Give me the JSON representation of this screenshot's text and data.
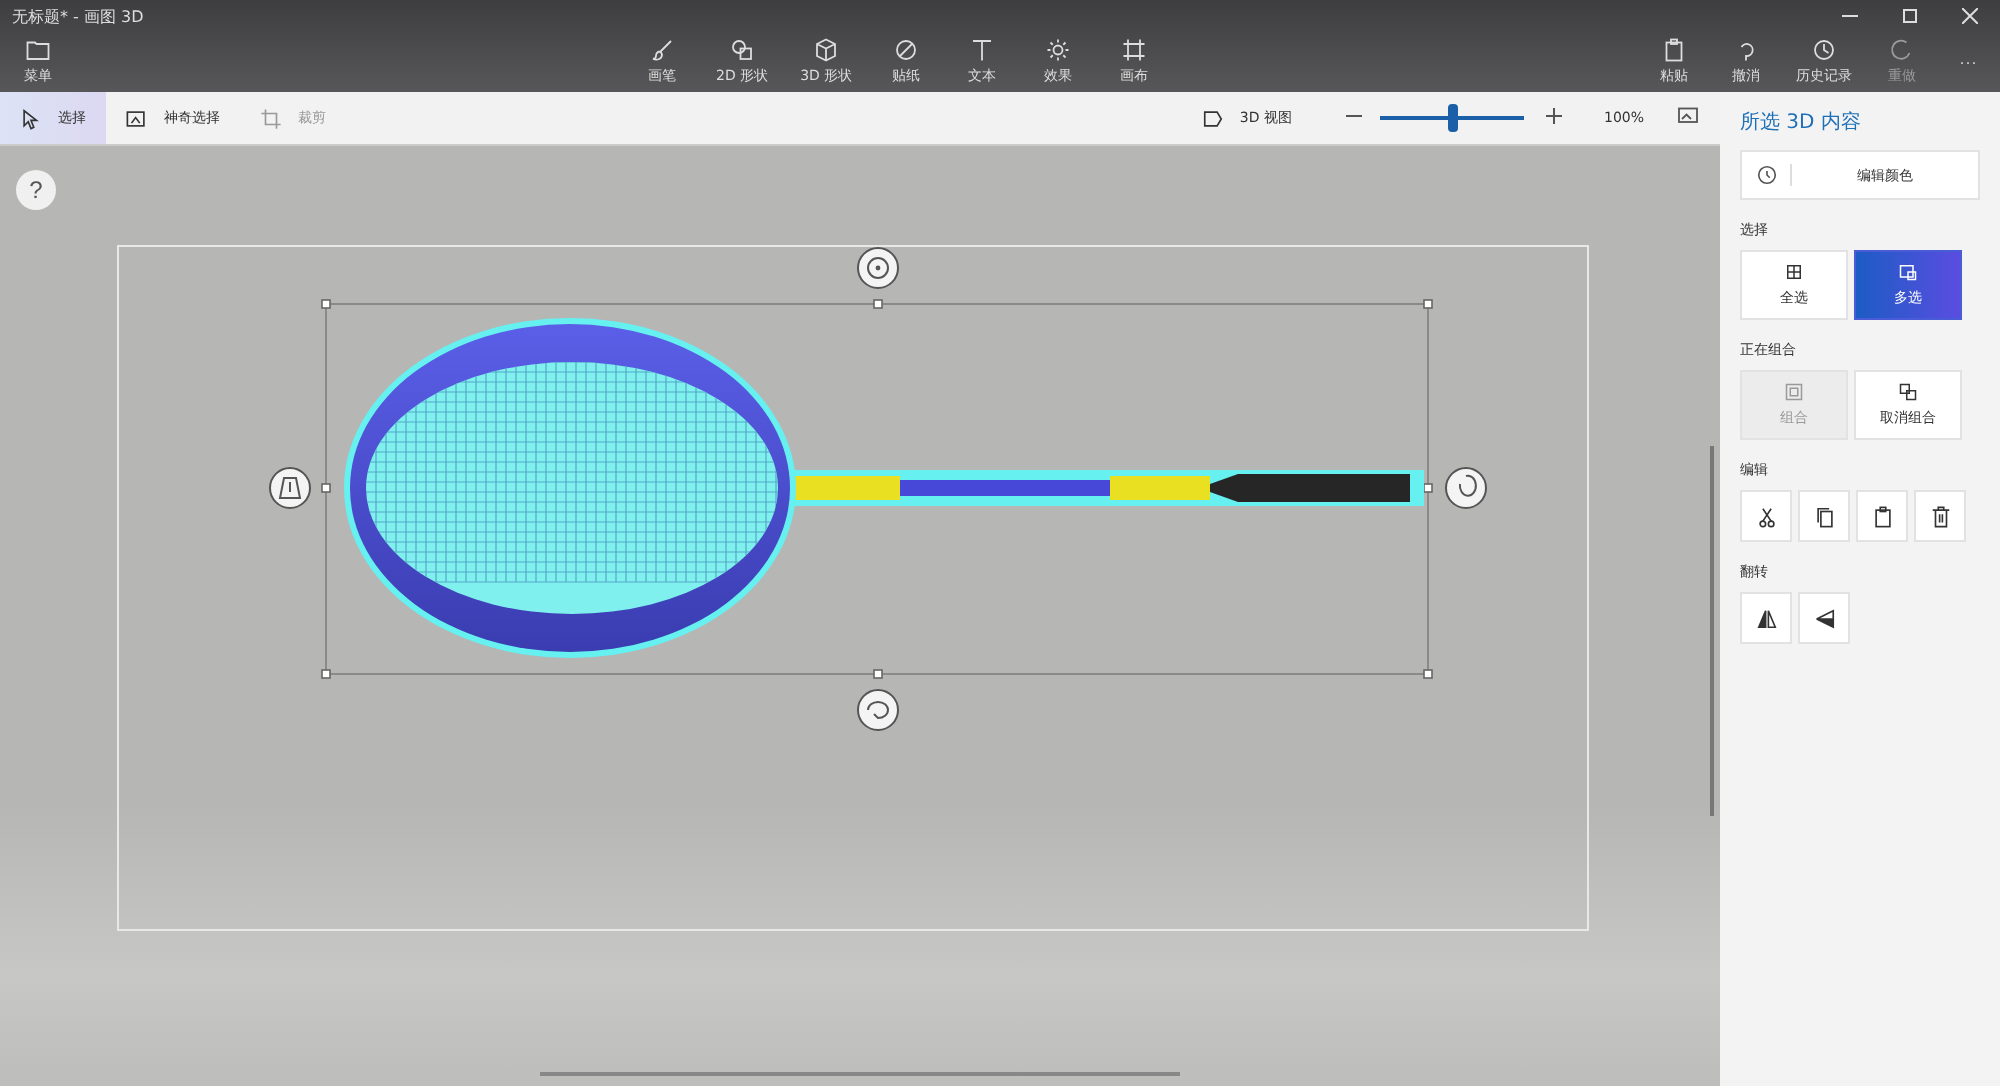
{
  "window": {
    "title": "无标题* - 画图 3D"
  },
  "menu_button": {
    "label": "菜单"
  },
  "tools": [
    {
      "label": "画笔"
    },
    {
      "label": "2D 形状"
    },
    {
      "label": "3D 形状"
    },
    {
      "label": "贴纸"
    },
    {
      "label": "文本"
    },
    {
      "label": "效果"
    },
    {
      "label": "画布"
    }
  ],
  "actions": [
    {
      "label": "粘贴",
      "disabled": false
    },
    {
      "label": "撤消",
      "disabled": false
    },
    {
      "label": "历史记录",
      "disabled": false
    },
    {
      "label": "重做",
      "disabled": true
    }
  ],
  "more_button": {
    "label": "···"
  },
  "toolbar": {
    "items": [
      {
        "label": "选择",
        "selected": true,
        "disabled": false
      },
      {
        "label": "神奇选择",
        "selected": false,
        "disabled": false
      },
      {
        "label": "裁剪",
        "selected": false,
        "disabled": true
      }
    ],
    "view_3d": "3D 视图",
    "zoom": {
      "level": 0.5
    },
    "zoom_reading": "100%"
  },
  "help_button": {
    "label": "?"
  },
  "panel": {
    "title": "所选 3D 内容",
    "edit_color": "编辑颜色",
    "sections": [
      {
        "heading": "选择",
        "kind": "labeled",
        "buttons": [
          {
            "label": "全选",
            "selected": false,
            "disabled": false
          },
          {
            "label": "多选",
            "selected": true,
            "disabled": false
          }
        ]
      },
      {
        "heading": "正在组合",
        "kind": "labeled",
        "buttons": [
          {
            "label": "组合",
            "selected": false,
            "disabled": true
          },
          {
            "label": "取消组合",
            "selected": false,
            "disabled": false
          }
        ]
      },
      {
        "heading": "编辑",
        "kind": "icons"
      },
      {
        "heading": "翻转",
        "kind": "icons"
      }
    ]
  }
}
